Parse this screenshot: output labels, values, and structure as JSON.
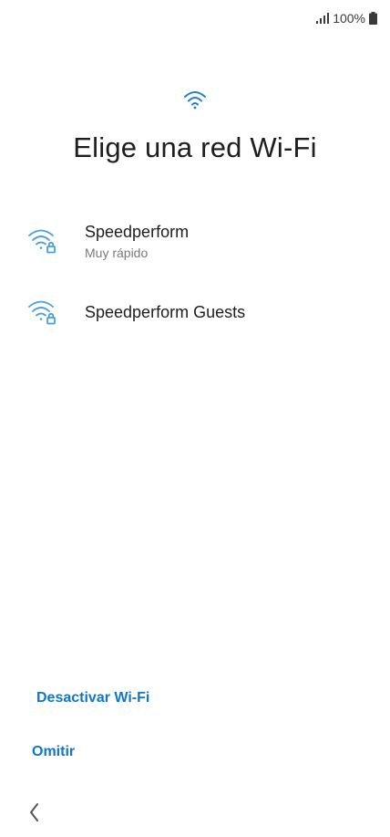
{
  "status_bar": {
    "battery_text": "100%",
    "signal_icon": "signal-bars-icon",
    "battery_icon": "battery-icon"
  },
  "header": {
    "icon": "wifi-icon",
    "title": "Elige una red Wi-Fi"
  },
  "networks": [
    {
      "name": "Speedperform",
      "subtitle": "Muy rápido",
      "icon": "wifi-locked-icon"
    },
    {
      "name": "Speedperform Guests",
      "subtitle": "",
      "icon": "wifi-locked-icon"
    }
  ],
  "actions": {
    "disable_wifi": "Desactivar Wi-Fi",
    "skip": "Omitir"
  },
  "navigation": {
    "back_icon": "chevron-left-icon"
  },
  "colors": {
    "accent": "#1275c9",
    "wifi_icon": "#4a9ee0",
    "text_primary": "#1e1e1e",
    "text_secondary": "#7a7a7a"
  }
}
